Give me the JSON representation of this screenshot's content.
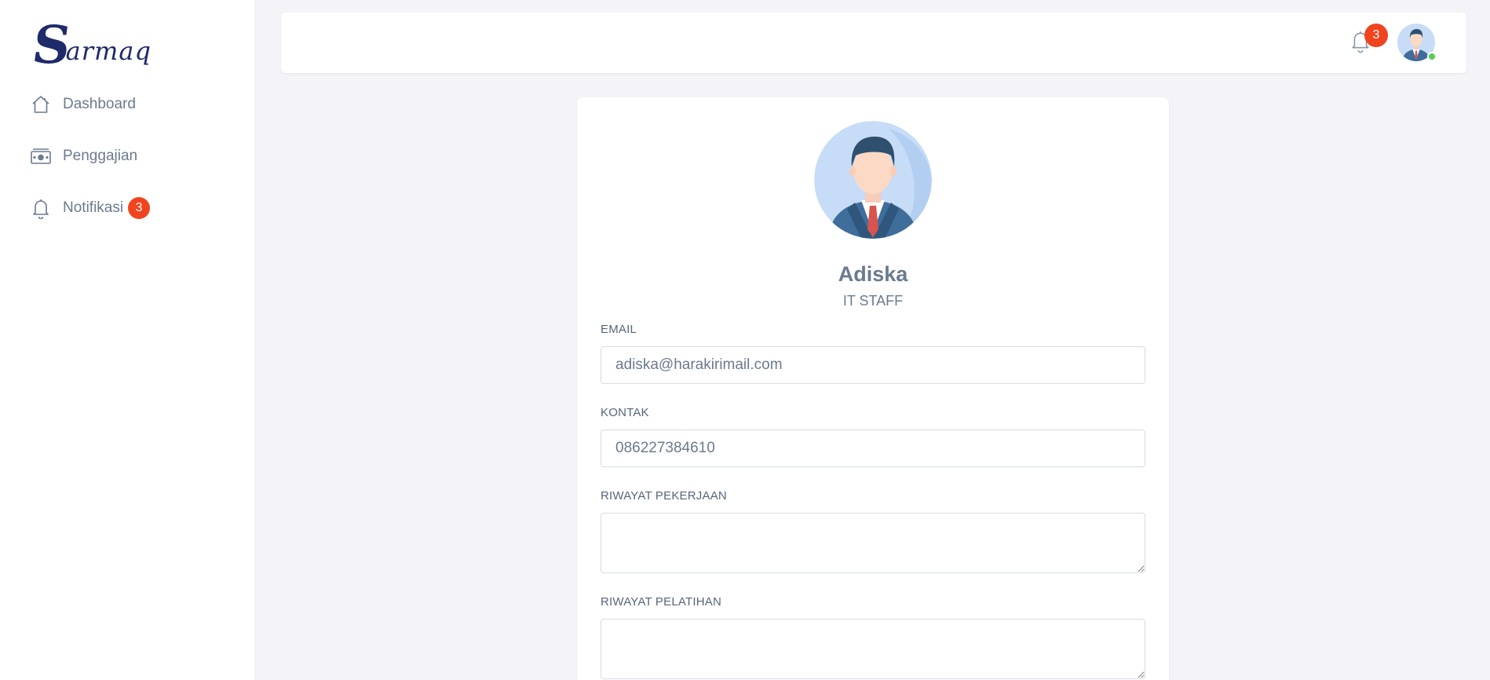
{
  "brand": {
    "logo_s": "S",
    "logo_rest": "armaq"
  },
  "sidebar": {
    "items": [
      {
        "label": "Dashboard",
        "icon": "home-icon"
      },
      {
        "label": "Penggajian",
        "icon": "money-icon"
      },
      {
        "label": "Notifikasi",
        "icon": "bell-icon",
        "badge": "3"
      }
    ]
  },
  "header": {
    "notification_count": "3",
    "icon": "bell-icon"
  },
  "profile": {
    "name": "Adiska",
    "role": "IT STAFF",
    "fields": {
      "email": {
        "label": "EMAIL",
        "value": "adiska@harakirimail.com"
      },
      "kontak": {
        "label": "KONTAK",
        "value": "086227384610"
      },
      "riwayat_pekerjaan": {
        "label": "RIWAYAT PEKERJAAN",
        "value": ""
      },
      "riwayat_pelatihan": {
        "label": "RIWAYAT PELATIHAN",
        "value": ""
      }
    }
  },
  "colors": {
    "accent_badge": "#f0441f",
    "online": "#56cc52",
    "logo": "#1f2a6b",
    "avatar_bg": "#c7dcf7"
  }
}
